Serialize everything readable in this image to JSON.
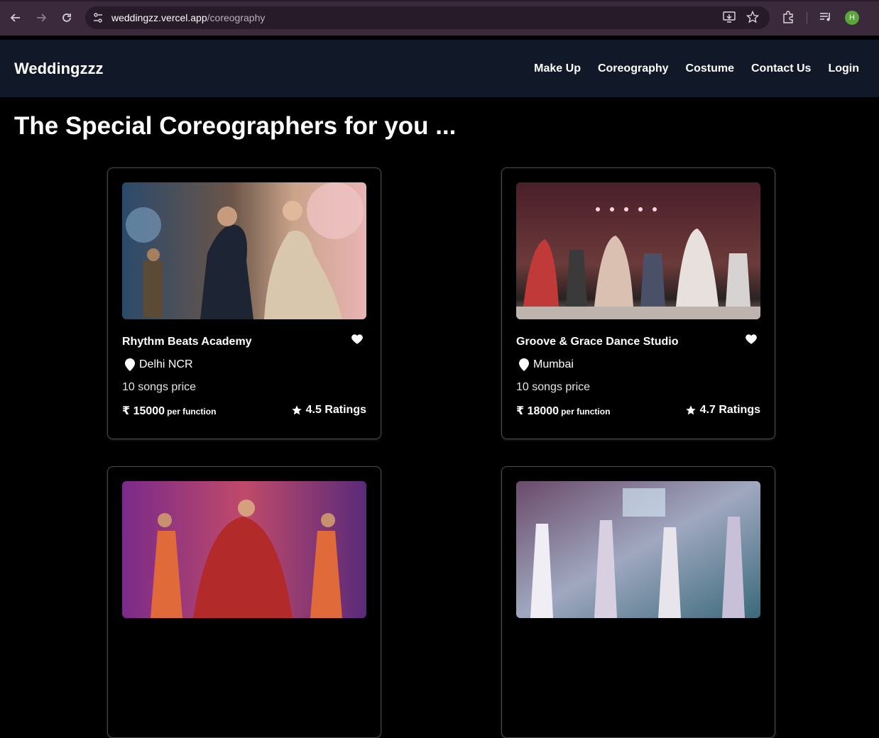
{
  "browser": {
    "url_host": "weddingzz.vercel.app",
    "url_path": "/coreography",
    "avatar_letter": "H",
    "icons": [
      "back-icon",
      "forward-icon",
      "reload-icon",
      "site-settings-icon",
      "install-icon",
      "bookmark-star-icon",
      "extensions-icon",
      "media-control-icon",
      "profile-avatar"
    ]
  },
  "navbar": {
    "brand": "Weddingzzz",
    "links": [
      "Make Up",
      "Coreography",
      "Costume",
      "Contact Us",
      "Login"
    ]
  },
  "heading": "The Special Coreographers for you ...",
  "cards": [
    {
      "title": "Rhythm Beats Academy",
      "location": "Delhi NCR",
      "songs": "10 songs price",
      "price": "₹ 15000",
      "price_unit": "per function",
      "rating": "4.5 Ratings"
    },
    {
      "title": "Groove & Grace Dance Studio",
      "location": "Mumbai",
      "songs": "10 songs price",
      "price": "₹ 18000",
      "price_unit": "per function",
      "rating": "4.7 Ratings"
    },
    {},
    {}
  ],
  "colors": {
    "navbar_bg": "#111827",
    "page_bg": "#000000",
    "chrome_bg": "#3a2a3c"
  }
}
